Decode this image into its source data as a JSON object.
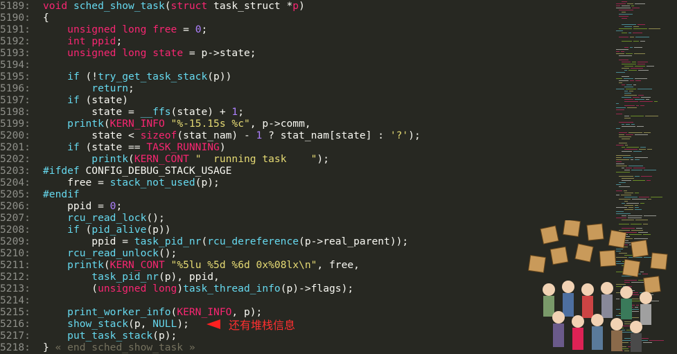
{
  "editor": {
    "lines": [
      {
        "n": "5189:",
        "t": [
          [
            "kw",
            "void "
          ],
          [
            "fn",
            "sched_show_task"
          ],
          [
            "plain",
            "("
          ],
          [
            "kw",
            "struct"
          ],
          [
            "plain",
            " task_struct *"
          ],
          [
            "kw",
            "p"
          ],
          [
            "plain",
            ")"
          ]
        ]
      },
      {
        "n": "5190:",
        "t": [
          [
            "plain",
            "{"
          ]
        ]
      },
      {
        "n": "5191:",
        "t": [
          [
            "plain",
            "    "
          ],
          [
            "kw",
            "unsigned long"
          ],
          [
            "plain",
            " "
          ],
          [
            "kw",
            "free"
          ],
          [
            "plain",
            " = "
          ],
          [
            "num",
            "0"
          ],
          [
            "plain",
            ";"
          ]
        ]
      },
      {
        "n": "5192:",
        "t": [
          [
            "plain",
            "    "
          ],
          [
            "kw",
            "int"
          ],
          [
            "plain",
            " "
          ],
          [
            "kw",
            "ppid"
          ],
          [
            "plain",
            ";"
          ]
        ]
      },
      {
        "n": "5193:",
        "t": [
          [
            "plain",
            "    "
          ],
          [
            "kw",
            "unsigned long"
          ],
          [
            "plain",
            " "
          ],
          [
            "kw",
            "state"
          ],
          [
            "plain",
            " = p->state;"
          ]
        ]
      },
      {
        "n": "5194:",
        "t": []
      },
      {
        "n": "5195:",
        "t": [
          [
            "plain",
            "    "
          ],
          [
            "fn",
            "if"
          ],
          [
            "plain",
            " (!"
          ],
          [
            "fn",
            "try_get_task_stack"
          ],
          [
            "plain",
            "(p))"
          ]
        ]
      },
      {
        "n": "5196:",
        "t": [
          [
            "plain",
            "        "
          ],
          [
            "fn",
            "return"
          ],
          [
            "plain",
            ";"
          ]
        ]
      },
      {
        "n": "5197:",
        "t": [
          [
            "plain",
            "    "
          ],
          [
            "fn",
            "if"
          ],
          [
            "plain",
            " (state)"
          ]
        ]
      },
      {
        "n": "5198:",
        "t": [
          [
            "plain",
            "        state = "
          ],
          [
            "fn",
            "__ffs"
          ],
          [
            "plain",
            "(state) + "
          ],
          [
            "num",
            "1"
          ],
          [
            "plain",
            ";"
          ]
        ]
      },
      {
        "n": "5199:",
        "t": [
          [
            "plain",
            "    "
          ],
          [
            "fn",
            "printk"
          ],
          [
            "plain",
            "("
          ],
          [
            "kw",
            "KERN_INFO"
          ],
          [
            "plain",
            " "
          ],
          [
            "str",
            "\"%-15.15s %c\""
          ],
          [
            "plain",
            ", p->comm,"
          ]
        ]
      },
      {
        "n": "5200:",
        "t": [
          [
            "plain",
            "        state < "
          ],
          [
            "kw",
            "sizeof"
          ],
          [
            "plain",
            "(stat_nam) - "
          ],
          [
            "num",
            "1"
          ],
          [
            "plain",
            " ? stat_nam[state] : "
          ],
          [
            "str",
            "'?'"
          ],
          [
            "plain",
            ");"
          ]
        ]
      },
      {
        "n": "5201:",
        "t": [
          [
            "plain",
            "    "
          ],
          [
            "fn",
            "if"
          ],
          [
            "plain",
            " (state == "
          ],
          [
            "kw",
            "TASK_RUNNING"
          ],
          [
            "plain",
            ")"
          ]
        ]
      },
      {
        "n": "5202:",
        "t": [
          [
            "plain",
            "        "
          ],
          [
            "fn",
            "printk"
          ],
          [
            "plain",
            "("
          ],
          [
            "kw",
            "KERN_CONT"
          ],
          [
            "plain",
            " "
          ],
          [
            "str",
            "\"  running task    \""
          ],
          [
            "plain",
            ");"
          ]
        ]
      },
      {
        "n": "5203:",
        "t": [
          [
            "fn",
            "#ifdef"
          ],
          [
            "plain",
            " CONFIG_DEBUG_STACK_USAGE"
          ]
        ]
      },
      {
        "n": "5204:",
        "t": [
          [
            "plain",
            "    free = "
          ],
          [
            "fn",
            "stack_not_used"
          ],
          [
            "plain",
            "(p);"
          ]
        ]
      },
      {
        "n": "5205:",
        "t": [
          [
            "fn",
            "#endif"
          ]
        ]
      },
      {
        "n": "5206:",
        "t": [
          [
            "plain",
            "    ppid = "
          ],
          [
            "num",
            "0"
          ],
          [
            "plain",
            ";"
          ]
        ]
      },
      {
        "n": "5207:",
        "t": [
          [
            "plain",
            "    "
          ],
          [
            "fn",
            "rcu_read_lock"
          ],
          [
            "plain",
            "();"
          ]
        ]
      },
      {
        "n": "5208:",
        "t": [
          [
            "plain",
            "    "
          ],
          [
            "fn",
            "if"
          ],
          [
            "plain",
            " ("
          ],
          [
            "fn",
            "pid_alive"
          ],
          [
            "plain",
            "(p))"
          ]
        ]
      },
      {
        "n": "5209:",
        "t": [
          [
            "plain",
            "        ppid = "
          ],
          [
            "fn",
            "task_pid_nr"
          ],
          [
            "plain",
            "("
          ],
          [
            "fn",
            "rcu_dereference"
          ],
          [
            "plain",
            "(p->real_parent));"
          ]
        ]
      },
      {
        "n": "5210:",
        "t": [
          [
            "plain",
            "    "
          ],
          [
            "fn",
            "rcu_read_unlock"
          ],
          [
            "plain",
            "();"
          ]
        ]
      },
      {
        "n": "5211:",
        "t": [
          [
            "plain",
            "    "
          ],
          [
            "fn",
            "printk"
          ],
          [
            "plain",
            "("
          ],
          [
            "kw",
            "KERN_CONT"
          ],
          [
            "plain",
            " "
          ],
          [
            "str",
            "\"%5lu %5d %6d 0x%08lx\\n\""
          ],
          [
            "plain",
            ", free,"
          ]
        ]
      },
      {
        "n": "5212:",
        "t": [
          [
            "plain",
            "        "
          ],
          [
            "fn",
            "task_pid_nr"
          ],
          [
            "plain",
            "(p), ppid,"
          ]
        ]
      },
      {
        "n": "5213:",
        "t": [
          [
            "plain",
            "        ("
          ],
          [
            "kw",
            "unsigned long"
          ],
          [
            "plain",
            ")"
          ],
          [
            "fn",
            "task_thread_info"
          ],
          [
            "plain",
            "(p)->flags);"
          ]
        ]
      },
      {
        "n": "5214:",
        "t": []
      },
      {
        "n": "5215:",
        "t": [
          [
            "plain",
            "    "
          ],
          [
            "fn",
            "print_worker_info"
          ],
          [
            "plain",
            "("
          ],
          [
            "kw",
            "KERN_INFO"
          ],
          [
            "plain",
            ", p);"
          ]
        ]
      },
      {
        "n": "5216:",
        "t": [
          [
            "plain",
            "    "
          ],
          [
            "fn",
            "show_stack"
          ],
          [
            "plain",
            "(p, "
          ],
          [
            "fn",
            "NULL"
          ],
          [
            "plain",
            ");"
          ]
        ]
      },
      {
        "n": "5217:",
        "t": [
          [
            "plain",
            "    "
          ],
          [
            "fn",
            "put_task_stack"
          ],
          [
            "plain",
            "(p);"
          ]
        ]
      },
      {
        "n": "5218:",
        "t": [
          [
            "plain",
            "} "
          ],
          [
            "cmt",
            "« end sched_show_task »"
          ]
        ]
      }
    ]
  },
  "annotation": {
    "text": "还有堆栈信息"
  },
  "colors": {
    "background": "#272822",
    "keyword": "#f92672",
    "function": "#66d9ef",
    "string": "#e6db74",
    "number": "#ae81ff",
    "comment": "#75715e"
  }
}
